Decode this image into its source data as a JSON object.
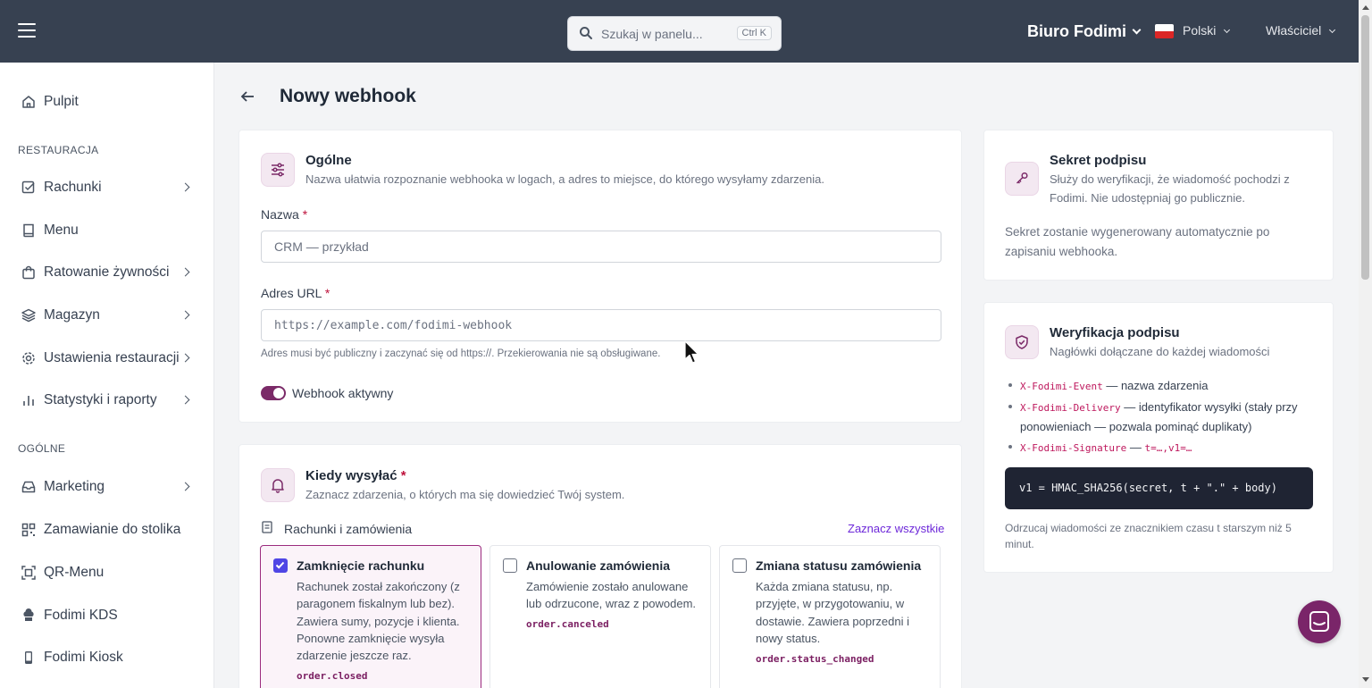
{
  "topbar": {
    "search_placeholder": "Szukaj w panelu...",
    "search_shortcut": "Ctrl K",
    "org_name": "Biuro Fodimi",
    "language": "Polski",
    "user": "Właściciel"
  },
  "sidebar": {
    "dashboard": "Pulpit",
    "section_restaurant": "RESTAURACJA",
    "section_general": "OGÓLNE",
    "items": {
      "bills": "Rachunki",
      "menu": "Menu",
      "food_rescue": "Ratowanie żywności",
      "inventory": "Magazyn",
      "settings": "Ustawienia restauracji",
      "stats": "Statystyki i raporty",
      "marketing": "Marketing",
      "table_ordering": "Zamawianie do stolika",
      "qr_menu": "QR-Menu",
      "kds": "Fodimi KDS",
      "kiosk": "Fodimi Kiosk"
    }
  },
  "page": {
    "title": "Nowy webhook"
  },
  "general": {
    "title": "Ogólne",
    "subtitle": "Nazwa ułatwia rozpoznanie webhooka w logach, a adres to miejsce, do którego wysyłamy zdarzenia.",
    "name_label": "Nazwa",
    "name_placeholder": "CRM — przykład",
    "url_label": "Adres URL",
    "url_placeholder": "https://example.com/fodimi-webhook",
    "url_hint": "Adres musi być publiczny i zaczynać się od https://. Przekierowania nie są obsługiwane.",
    "active_label": "Webhook aktywny",
    "required_mark": "*"
  },
  "events": {
    "title": "Kiedy wysyłać",
    "subtitle": "Zaznacz zdarzenia, o których ma się dowiedzieć Twój system.",
    "group_label": "Rachunki i zamówienia",
    "select_all": "Zaznacz wszystkie",
    "cards": [
      {
        "title": "Zamknięcie rachunku",
        "desc": "Rachunek został zakończony (z paragonem fiskalnym lub bez). Zawiera sumy, pozycje i klienta. Ponowne zamknięcie wysyła zdarzenie jeszcze raz.",
        "code": "order.closed",
        "checked": true
      },
      {
        "title": "Anulowanie zamówienia",
        "desc": "Zamówienie zostało anulowane lub odrzucone, wraz z powodem.",
        "code": "order.canceled",
        "checked": false
      },
      {
        "title": "Zmiana statusu zamówienia",
        "desc": "Każda zmiana statusu, np. przyjęte, w przygotowaniu, w dostawie. Zawiera poprzedni i nowy status.",
        "code": "order.status_changed",
        "checked": false
      }
    ]
  },
  "secret": {
    "title": "Sekret podpisu",
    "subtitle": "Służy do weryfikacji, że wiadomość pochodzi z Fodimi. Nie udostępniaj go publicznie.",
    "note": "Sekret zostanie wygenerowany automatycznie po zapisaniu webhooka."
  },
  "verify": {
    "title": "Weryfikacja podpisu",
    "subtitle": "Nagłówki dołączane do każdej wiadomości",
    "headers": [
      {
        "name": "X-Fodimi-Event",
        "desc": " — nazwa zdarzenia"
      },
      {
        "name": "X-Fodimi-Delivery",
        "desc": " — identyfikator wysyłki (stały przy ponowieniach — pozwala pominąć duplikaty)"
      },
      {
        "name": "X-Fodimi-Signature",
        "desc": " — ",
        "extra": "t=…,v1=…"
      }
    ],
    "code": "v1 = HMAC_SHA256(secret, t + \".\" + body)",
    "note": "Odrzucaj wiadomości ze znacznikiem czasu t starszym niż 5 minut."
  },
  "colors": {
    "brand": "#7b2a68",
    "topbar": "#374151",
    "checkbox": "#4f46e5"
  }
}
